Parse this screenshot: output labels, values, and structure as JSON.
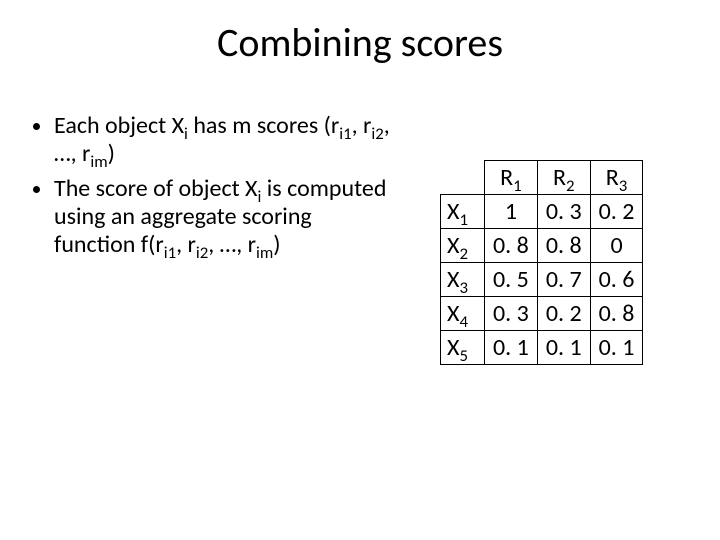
{
  "title": "Combining scores",
  "bullets": {
    "b1_pre": "Each object X",
    "b1_sub1": "i",
    "b1_mid": " has m scores (r",
    "b1_sub2": "i1",
    "b1_mid2": ", r",
    "b1_sub3": "i2",
    "b1_mid3": ", …, r",
    "b1_sub4": "im",
    "b1_post": ")",
    "b2_pre": "The score of object X",
    "b2_sub1": "i",
    "b2_mid": " is computed using an aggregate scoring function f(r",
    "b2_sub2": "i1",
    "b2_mid2": ", r",
    "b2_sub3": "i2",
    "b2_mid3": ", …, r",
    "b2_sub4": "im",
    "b2_post": ")"
  },
  "table": {
    "colheads": {
      "c1": "R",
      "c1s": "1",
      "c2": "R",
      "c2s": "2",
      "c3": "R",
      "c3s": "3"
    },
    "rows": [
      {
        "name": "X",
        "sub": "1",
        "v1": "1",
        "v2": "0. 3",
        "v3": "0. 2"
      },
      {
        "name": "X",
        "sub": "2",
        "v1": "0. 8",
        "v2": "0. 8",
        "v3": "0"
      },
      {
        "name": "X",
        "sub": "3",
        "v1": "0. 5",
        "v2": "0. 7",
        "v3": "0. 6"
      },
      {
        "name": "X",
        "sub": "4",
        "v1": "0. 3",
        "v2": "0. 2",
        "v3": "0. 8"
      },
      {
        "name": "X",
        "sub": "5",
        "v1": "0. 1",
        "v2": "0. 1",
        "v3": "0. 1"
      }
    ]
  },
  "chart_data": {
    "type": "table",
    "columns": [
      "",
      "R1",
      "R2",
      "R3"
    ],
    "rows": [
      [
        "X1",
        1,
        0.3,
        0.2
      ],
      [
        "X2",
        0.8,
        0.8,
        0
      ],
      [
        "X3",
        0.5,
        0.7,
        0.6
      ],
      [
        "X4",
        0.3,
        0.2,
        0.8
      ],
      [
        "X5",
        0.1,
        0.1,
        0.1
      ]
    ]
  }
}
